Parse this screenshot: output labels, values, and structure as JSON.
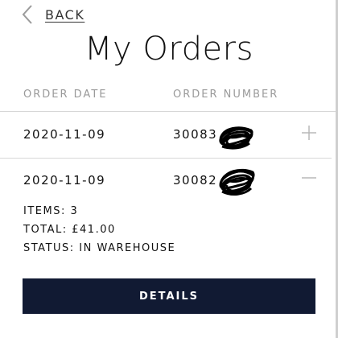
{
  "nav": {
    "back_label": "BACK"
  },
  "page": {
    "title": "My Orders"
  },
  "table": {
    "headers": {
      "order_date": "ORDER DATE",
      "order_number": "ORDER NUMBER"
    }
  },
  "orders": [
    {
      "date": "2020-11-09",
      "number_visible": "30083",
      "expanded": false
    },
    {
      "date": "2020-11-09",
      "number_visible": "30082",
      "expanded": true,
      "items": "ITEMS: 3",
      "total": "TOTAL: £41.00",
      "status": "STATUS: IN WAREHOUSE"
    }
  ],
  "actions": {
    "details_label": "DETAILS"
  },
  "colors": {
    "button_bg": "#111a33",
    "header_text": "#9a9a9a",
    "divider": "#d7d7d7"
  },
  "icons": {
    "back": "chevron-left-icon",
    "expand": "plus-icon",
    "collapse": "minus-icon",
    "redaction": "scribble-redaction"
  }
}
